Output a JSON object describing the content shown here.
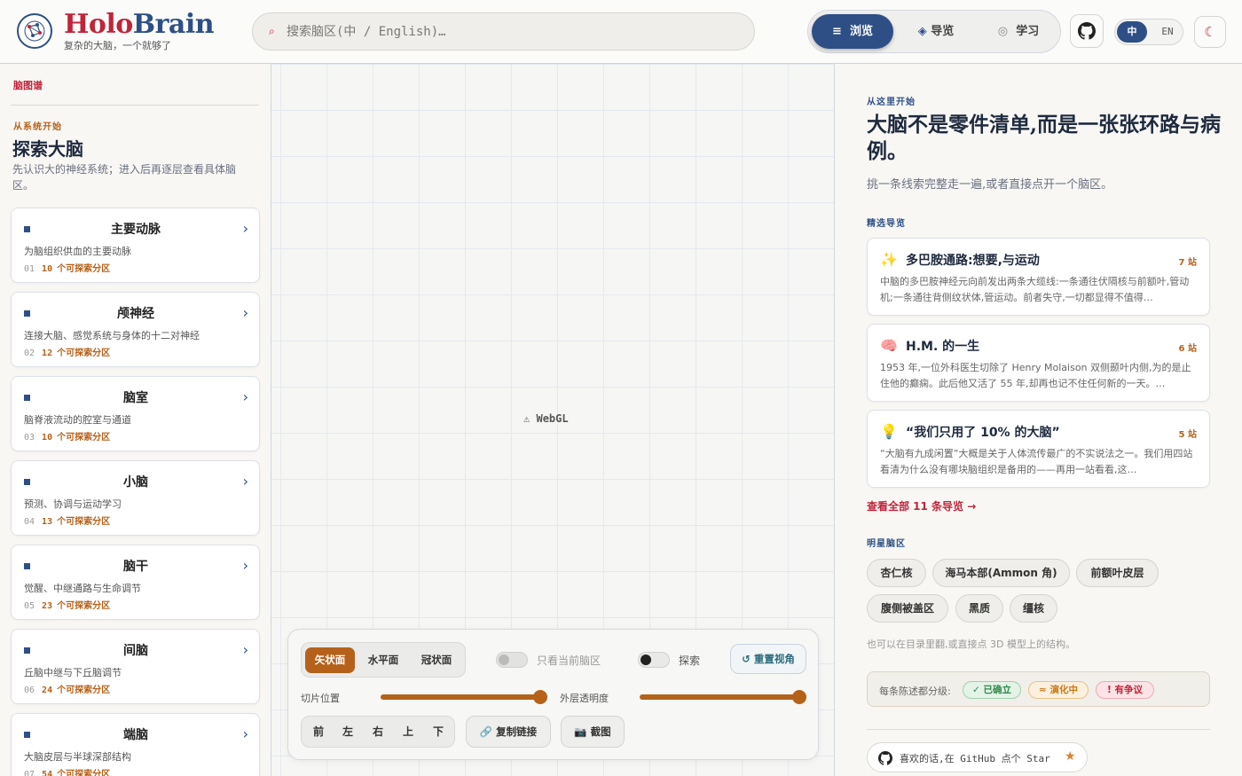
{
  "header": {
    "brand_part1": "Holo",
    "brand_part2": "Brain",
    "tagline": "复杂的大脑，一个就够了",
    "search_placeholder": "搜索脑区(中 / English)…",
    "modes": [
      {
        "icon": "≡",
        "label": "浏览",
        "active": true
      },
      {
        "icon": "◈",
        "label": "导览",
        "active": false
      },
      {
        "icon": "◎",
        "label": "学习",
        "active": false
      }
    ],
    "lang_active": "中",
    "lang_other": "EN",
    "theme_icon": "☾"
  },
  "sidebar": {
    "breadcrumb": "脑图谱",
    "kicker": "从系统开始",
    "title": "探索大脑",
    "description": "先认识大的神经系统；进入后再逐层查看具体脑区。",
    "suffix": "个可探索分区",
    "items": [
      {
        "title": "主要动脉",
        "desc": "为脑组织供血的主要动脉",
        "num": "01",
        "count": "10"
      },
      {
        "title": "颅神经",
        "desc": "连接大脑、感觉系统与身体的十二对神经",
        "num": "02",
        "count": "12"
      },
      {
        "title": "脑室",
        "desc": "脑脊液流动的腔室与通道",
        "num": "03",
        "count": "10"
      },
      {
        "title": "小脑",
        "desc": "预测、协调与运动学习",
        "num": "04",
        "count": "13"
      },
      {
        "title": "脑干",
        "desc": "觉醒、中继通路与生命调节",
        "num": "05",
        "count": "23"
      },
      {
        "title": "间脑",
        "desc": "丘脑中继与下丘脑调节",
        "num": "06",
        "count": "24"
      },
      {
        "title": "端脑",
        "desc": "大脑皮层与半球深部结构",
        "num": "07",
        "count": "54"
      }
    ]
  },
  "viewport": {
    "webgl_label": "WebGL",
    "planes": [
      "矢状面",
      "水平面",
      "冠状面"
    ],
    "active_plane": "矢状面",
    "only_current_label": "只看当前脑区",
    "explore_label": "探索",
    "reset_label": "重置视角",
    "slice_label": "切片位置",
    "slice_value": 1.0,
    "opacity_label": "外层透明度",
    "opacity_value": 1.0,
    "directions": [
      "前",
      "左",
      "右",
      "上",
      "下"
    ],
    "copy_link_label": "复制链接",
    "screenshot_label": "截图"
  },
  "right": {
    "kicker": "从这里开始",
    "title": "大脑不是零件清单,而是一张张环路与病例。",
    "subtitle": "挑一条线索完整走一遍,或者直接点开一个脑区。",
    "tours_kicker": "精选导览",
    "tours": [
      {
        "icon": "✨",
        "title": "多巴胺通路:想要,与运动",
        "stops": "7 站",
        "desc": "中脑的多巴胺神经元向前发出两条大缆线:一条通往伏隔核与前额叶,管动机;一条通往背侧纹状体,管运动。前者失守,一切都显得不值得…"
      },
      {
        "icon": "🧠",
        "title": "H.M. 的一生",
        "stops": "6 站",
        "desc": "1953 年,一位外科医生切除了 Henry Molaison 双侧颞叶内侧,为的是止住他的癫痫。此后他又活了 55 年,却再也记不住任何新的一天。…"
      },
      {
        "icon": "💡",
        "title": "“我们只用了 10% 的大脑”",
        "stops": "5 站",
        "desc": "“大脑有九成闲置”大概是关于人体流传最广的不实说法之一。我们用四站看清为什么没有哪块脑组织是备用的——再用一站看看,这…"
      }
    ],
    "view_all": "查看全部 11 条导览 →",
    "featured_kicker": "明星脑区",
    "chips": [
      "杏仁核",
      "海马本部(Ammon 角)",
      "前额叶皮层",
      "腹侧被盖区",
      "黑质",
      "缰核"
    ],
    "hint": "也可以在目录里翻,或直接点 3D 模型上的结构。",
    "legend_label": "每条陈述都分级:",
    "badges": [
      {
        "label": "✓ 已确立",
        "color": "#2f8a4a",
        "bg": "#e3f3e6",
        "border": "#9fd0ab"
      },
      {
        "label": "≈ 演化中",
        "color": "#c97a1a",
        "bg": "#fbefdd",
        "border": "#e8c28c"
      },
      {
        "label": "! 有争议",
        "color": "#c0243a",
        "bg": "#fbe3e6",
        "border": "#eeabb4"
      }
    ],
    "star_text": "喜欢的话,在 GitHub 点个 Star",
    "star_icon": "★"
  },
  "colors": {
    "brand_red": "#c0243a",
    "brand_blue": "#2e4f86",
    "accent_orange": "#b5611a"
  }
}
